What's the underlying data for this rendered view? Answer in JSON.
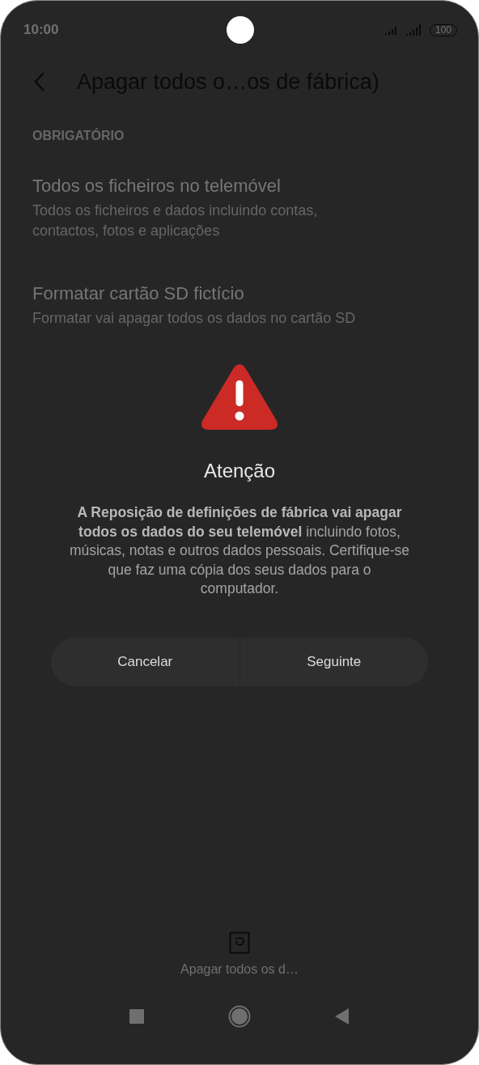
{
  "status_bar": {
    "time": "10:00",
    "battery": "100"
  },
  "header": {
    "title": "Apagar todos o…os de fábrica)"
  },
  "section": {
    "title": "OBRIGATÓRIO"
  },
  "items": [
    {
      "title": "Todos os ficheiros no telemóvel",
      "subtitle": "Todos os ficheiros e dados incluindo contas, contactos, fotos e aplicações"
    },
    {
      "title": "Formatar cartão SD fictício",
      "subtitle": "Formatar vai apagar todos os dados no cartão SD"
    }
  ],
  "dialog": {
    "title": "Atenção",
    "message": "**A Reposição de definições de fábrica vai apagar todos os dados do seu telemóvel** incluindo fotos, músicas, notas e outros dados pessoais. Certifique-se que faz uma cópia dos seus dados para o computador.",
    "buttons": [
      "Cancelar",
      "Seguinte"
    ]
  },
  "bottom_action": {
    "label": "Apagar todos os d…"
  }
}
